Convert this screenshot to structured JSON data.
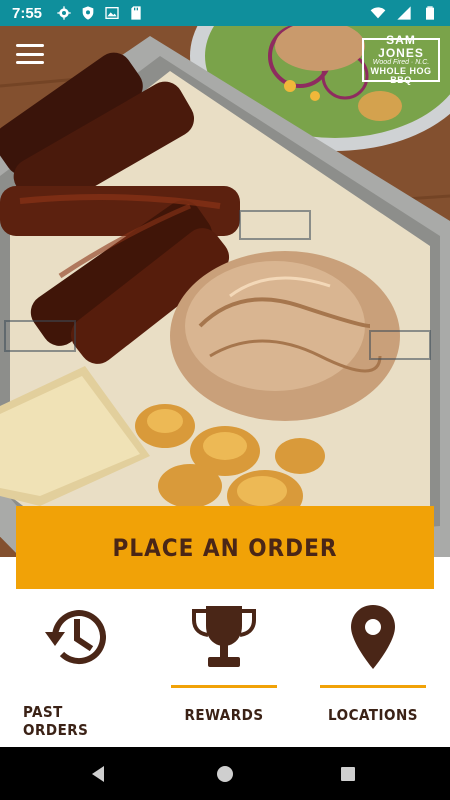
{
  "status_bar": {
    "time": "7:55",
    "icons_left": [
      "settings-icon",
      "shield-icon",
      "image-icon",
      "sd-card-icon"
    ],
    "icons_right": [
      "wifi-icon",
      "signal-icon",
      "battery-icon"
    ]
  },
  "header": {
    "menu_icon": "hamburger-icon",
    "logo": {
      "line1": "SAM JONES",
      "line2": "Wood Fired · N.C.",
      "line3": "WHOLE HOG BBQ"
    }
  },
  "order": {
    "label": "PLACE AN ORDER"
  },
  "nav": [
    {
      "label": "PAST ORDERS",
      "icon": "history-icon"
    },
    {
      "label": "REWARDS",
      "icon": "trophy-icon"
    },
    {
      "label": "LOCATIONS",
      "icon": "location-pin-icon"
    }
  ],
  "colors": {
    "status_bar": "#0f8f9c",
    "accent": "#f1a207",
    "icon": "#4a2617",
    "label": "#3b2216"
  },
  "android_nav": [
    "back-icon",
    "home-icon",
    "recents-icon"
  ]
}
